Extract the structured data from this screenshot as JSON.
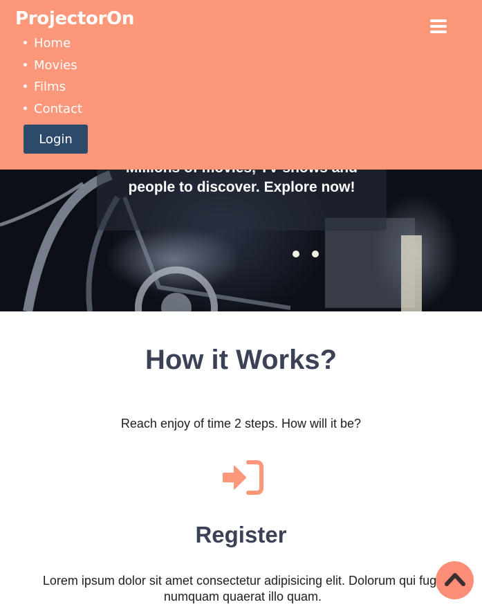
{
  "header": {
    "brand": "ProjectorOn",
    "nav": [
      "Home",
      "Movies",
      "Films",
      "Contact"
    ],
    "login_label": "Login",
    "menu_icon": "hamburger-menu-icon"
  },
  "hero": {
    "line1": "Millions of movies, TV shows and",
    "line2": "people to discover. Explore now!"
  },
  "how": {
    "title": "How it Works?",
    "subtitle": "Reach enjoy of time 2 steps. How will it be?"
  },
  "step": {
    "icon": "sign-in-icon",
    "title": "Register",
    "description": "Lorem ipsum dolor sit amet consectetur adipisicing elit. Dolorum qui fugit numquam quaerat illo quam."
  },
  "colors": {
    "accent": "#fc977a",
    "button": "#2e4a6b",
    "heading": "#3b4256"
  },
  "scroll_top_icon": "chevron-up-icon"
}
